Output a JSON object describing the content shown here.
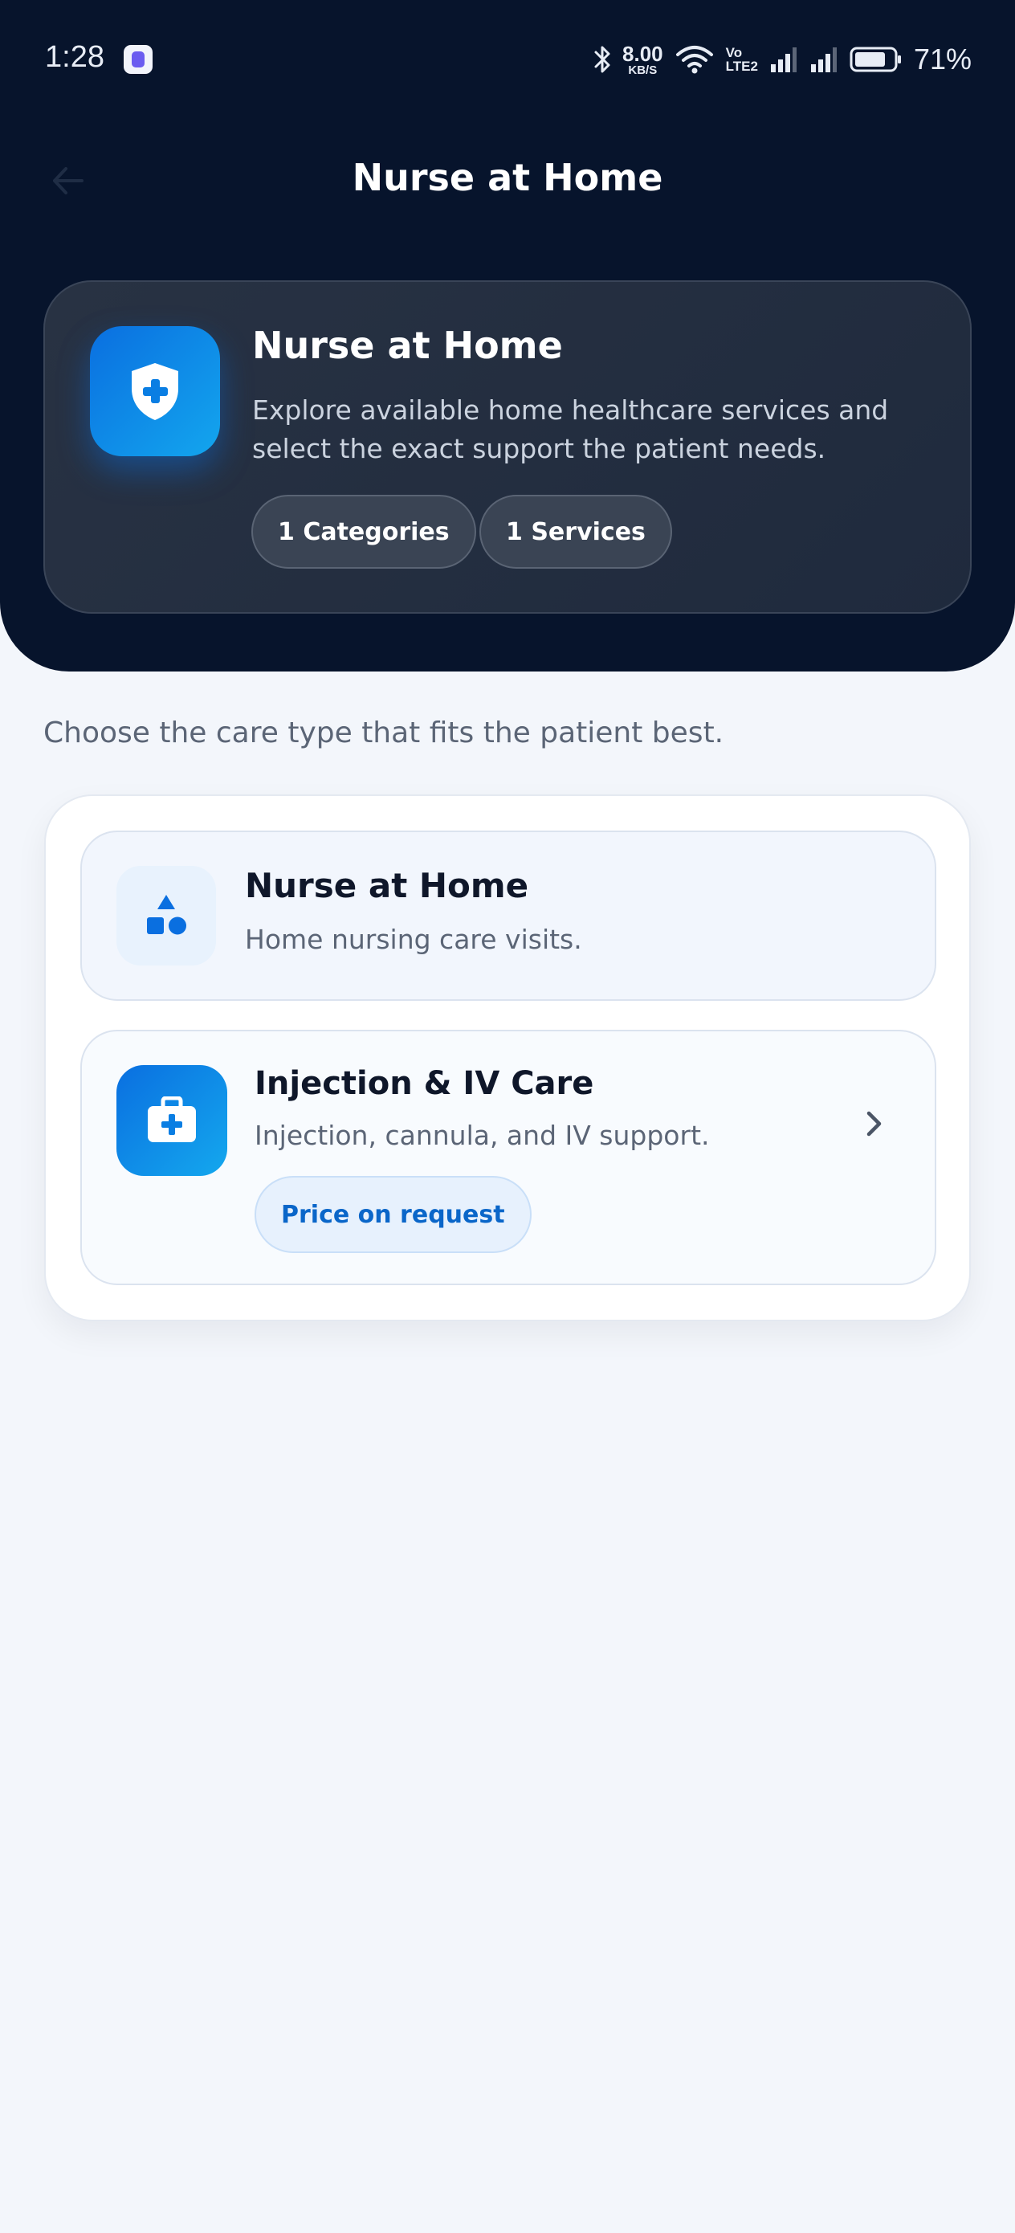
{
  "status_bar": {
    "time": "1:28",
    "speed_value": "8.00",
    "speed_unit": "KB/S",
    "lte_top": "Vo",
    "lte_bottom": "LTE2",
    "battery_percent": "71%"
  },
  "header": {
    "title": "Nurse at Home",
    "back_icon": "arrow-left-icon"
  },
  "hero": {
    "icon": "shield-plus-icon",
    "title": "Nurse at Home",
    "description": "Explore available home healthcare services and select the exact support the patient needs.",
    "categories_chip": "1 Categories",
    "services_chip": "1 Services"
  },
  "intro_text": "Choose the care type that fits the patient best.",
  "category": {
    "icon": "shapes-icon",
    "title": "Nurse at Home",
    "subtitle": "Home nursing care visits."
  },
  "service": {
    "icon": "medical-kit-icon",
    "title": "Injection & IV Care",
    "subtitle": "Injection, cannula, and IV support.",
    "price_label": "Price on request",
    "chevron_icon": "chevron-right-icon"
  },
  "colors": {
    "header_bg": "#07142c",
    "accent": "#0a6fe0",
    "page_bg": "#f3f6fb"
  }
}
